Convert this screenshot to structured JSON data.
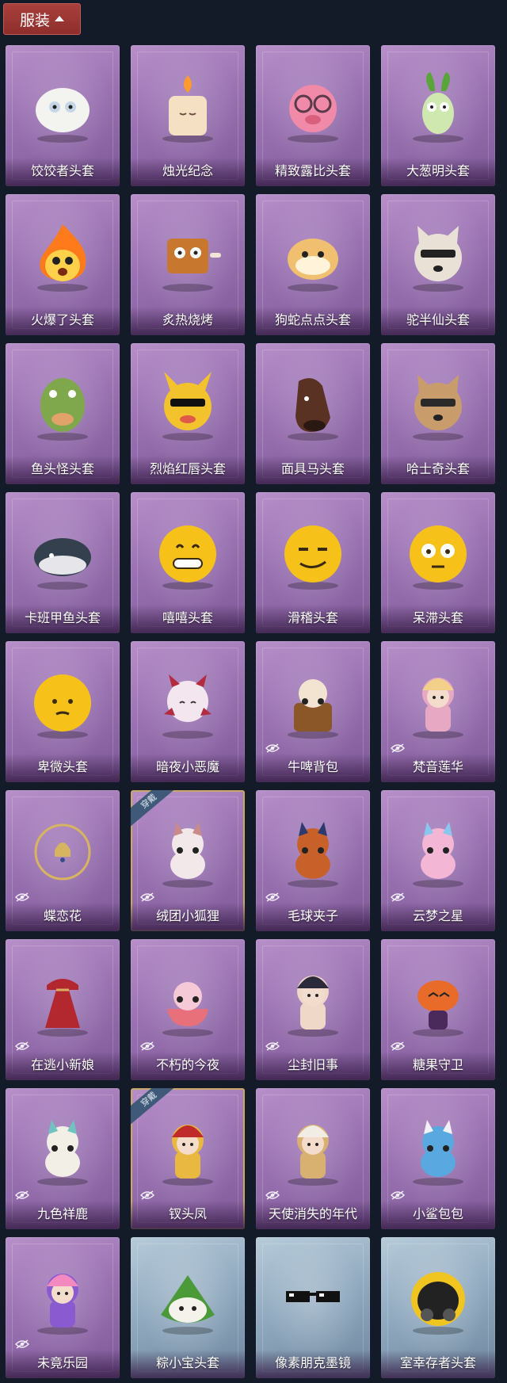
{
  "section": {
    "label": "服装"
  },
  "worn_badge": "穿戴",
  "items": [
    {
      "name": "饺饺者头套",
      "art": "dumpling",
      "c1": "#f3f3ef",
      "c2": "#c6d6e6",
      "bg": "purple",
      "eye": false,
      "worn": false
    },
    {
      "name": "烛光纪念",
      "art": "candle",
      "c1": "#f5e0c4",
      "c2": "#ff9a2e",
      "bg": "purple",
      "eye": false,
      "worn": false
    },
    {
      "name": "精致露比头套",
      "art": "pig",
      "c1": "#f08aa8",
      "c2": "#5a3a48",
      "bg": "purple",
      "eye": false,
      "worn": false
    },
    {
      "name": "大葱明头套",
      "art": "leek",
      "c1": "#cfe8b0",
      "c2": "#5aa53a",
      "bg": "purple",
      "eye": false,
      "worn": false
    },
    {
      "name": "火爆了头套",
      "art": "fire",
      "c1": "#ff7a1a",
      "c2": "#ffd04a",
      "bg": "purple",
      "eye": false,
      "worn": false
    },
    {
      "name": "炙热烧烤",
      "art": "bbq",
      "c1": "#c8782e",
      "c2": "#f1e6d6",
      "bg": "purple",
      "eye": false,
      "worn": false
    },
    {
      "name": "狗蛇点点头套",
      "art": "snake",
      "c1": "#f0c070",
      "c2": "#fff3da",
      "bg": "purple",
      "eye": false,
      "worn": false
    },
    {
      "name": "驼半仙头套",
      "art": "bear",
      "c1": "#e9e1d6",
      "c2": "#222222",
      "bg": "purple",
      "eye": false,
      "worn": false
    },
    {
      "name": "鱼头怪头套",
      "art": "fish",
      "c1": "#7fa84c",
      "c2": "#e2a36a",
      "bg": "purple",
      "eye": false,
      "worn": false
    },
    {
      "name": "烈焰红唇头套",
      "art": "pika",
      "c1": "#f2c32c",
      "c2": "#111111",
      "bg": "purple",
      "eye": false,
      "worn": false
    },
    {
      "name": "面具马头套",
      "art": "horse",
      "c1": "#5a3224",
      "c2": "#2a1812",
      "bg": "purple",
      "eye": false,
      "worn": false
    },
    {
      "name": "哈士奇头套",
      "art": "dog",
      "c1": "#c99d6b",
      "c2": "#2a2a2a",
      "bg": "purple",
      "eye": false,
      "worn": false
    },
    {
      "name": "卡班甲鱼头套",
      "art": "whale",
      "c1": "#35404f",
      "c2": "#e6e6ea",
      "bg": "purple",
      "eye": false,
      "worn": false
    },
    {
      "name": "嘻嘻头套",
      "art": "grin",
      "c1": "#f6c21a",
      "c2": "#3a2a10",
      "bg": "purple",
      "eye": false,
      "worn": false
    },
    {
      "name": "滑稽头套",
      "art": "smirk",
      "c1": "#f6c21a",
      "c2": "#3a2a10",
      "bg": "purple",
      "eye": false,
      "worn": false
    },
    {
      "name": "呆滞头套",
      "art": "stare",
      "c1": "#f6c21a",
      "c2": "#3a2a10",
      "bg": "purple",
      "eye": false,
      "worn": false
    },
    {
      "name": "卑微头套",
      "art": "shy",
      "c1": "#f6c21a",
      "c2": "#3a2a10",
      "bg": "purple",
      "eye": false,
      "worn": false
    },
    {
      "name": "暗夜小恶魔",
      "art": "devil",
      "c1": "#f4e6ee",
      "c2": "#b32b3e",
      "bg": "purple",
      "eye": false,
      "worn": false
    },
    {
      "name": "牛啤背包",
      "art": "keg",
      "c1": "#f3e4d2",
      "c2": "#8b5628",
      "bg": "purple",
      "eye": true,
      "worn": false
    },
    {
      "name": "梵音莲华",
      "art": "charm",
      "c1": "#f2d08a",
      "c2": "#e7a8c4",
      "bg": "purple",
      "eye": true,
      "worn": false
    },
    {
      "name": "蝶恋花",
      "art": "bell",
      "c1": "#d7b560",
      "c2": "#3a4a8e",
      "bg": "purple",
      "eye": true,
      "worn": false
    },
    {
      "name": "绒团小狐狸",
      "art": "fox",
      "c1": "#f2e8ea",
      "c2": "#c98a8a",
      "bg": "purple",
      "eye": true,
      "worn": true
    },
    {
      "name": "毛球夹子",
      "art": "raccoon",
      "c1": "#c8602a",
      "c2": "#2e3a6e",
      "bg": "purple",
      "eye": true,
      "worn": false
    },
    {
      "name": "云梦之星",
      "art": "unicorn",
      "c1": "#f3b6d4",
      "c2": "#8ac6ee",
      "bg": "purple",
      "eye": true,
      "worn": false
    },
    {
      "name": "在逃小新娘",
      "art": "dress",
      "c1": "#b3282e",
      "c2": "#d8b060",
      "bg": "purple",
      "eye": true,
      "worn": false
    },
    {
      "name": "不朽的今夜",
      "art": "catbowl",
      "c1": "#f6c9d6",
      "c2": "#e8707a",
      "bg": "purple",
      "eye": true,
      "worn": false
    },
    {
      "name": "尘封旧事",
      "art": "boy",
      "c1": "#2a2a3a",
      "c2": "#f0d8c8",
      "bg": "purple",
      "eye": true,
      "worn": false
    },
    {
      "name": "糖果守卫",
      "art": "pumpkin",
      "c1": "#e86b2a",
      "c2": "#4a2a5a",
      "bg": "purple",
      "eye": true,
      "worn": false
    },
    {
      "name": "九色祥鹿",
      "art": "deer",
      "c1": "#f2efe6",
      "c2": "#6fc3c0",
      "bg": "purple",
      "eye": true,
      "worn": false
    },
    {
      "name": "钗头凤",
      "art": "empress",
      "c1": "#c02a2a",
      "c2": "#e8b840",
      "bg": "purple",
      "eye": true,
      "worn": true
    },
    {
      "name": "天使消失的年代",
      "art": "angel",
      "c1": "#f1ece4",
      "c2": "#d8b070",
      "bg": "purple",
      "eye": true,
      "worn": false
    },
    {
      "name": "小鲨包包",
      "art": "shark",
      "c1": "#5aa8e0",
      "c2": "#f2f2f6",
      "bg": "purple",
      "eye": true,
      "worn": false
    },
    {
      "name": "未竟乐园",
      "art": "girl",
      "c1": "#f28ac0",
      "c2": "#8a5ad0",
      "bg": "purple",
      "eye": true,
      "worn": false
    },
    {
      "name": "粽小宝头套",
      "art": "zongzi",
      "c1": "#4a9a3a",
      "c2": "#f4f2ea",
      "bg": "blue",
      "eye": false,
      "worn": false
    },
    {
      "name": "像素朋克墨镜",
      "art": "pixel",
      "c1": "#111111",
      "c2": "#ffffff",
      "bg": "blue",
      "eye": false,
      "worn": false
    },
    {
      "name": "室幸存者头套",
      "art": "helmet",
      "c1": "#f0c520",
      "c2": "#222222",
      "bg": "blue",
      "eye": false,
      "worn": false
    }
  ]
}
